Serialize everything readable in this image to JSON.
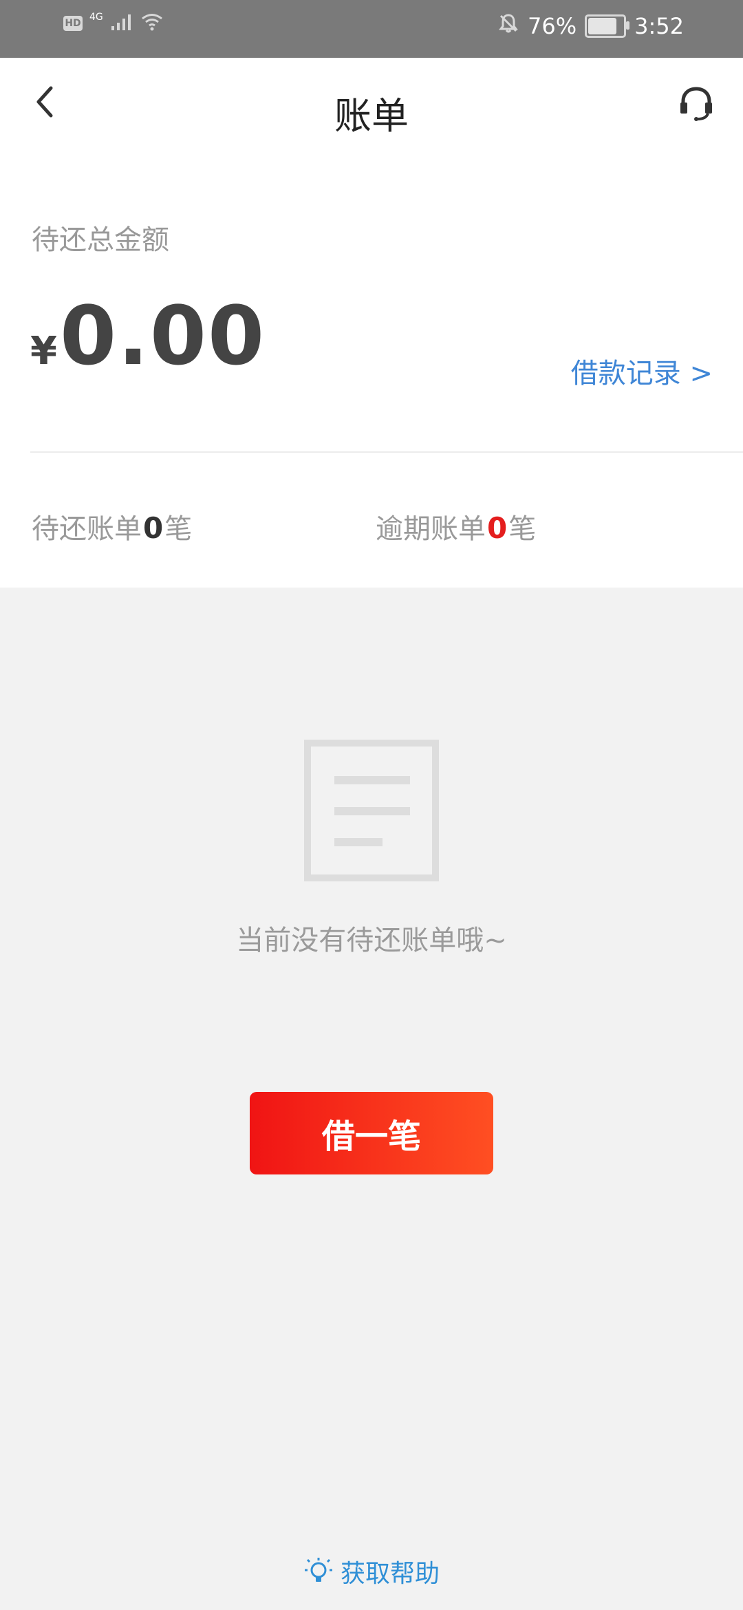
{
  "status_bar": {
    "network_type": "4G",
    "battery_percent": "76%",
    "time": "3:52"
  },
  "nav": {
    "title": "账单"
  },
  "summary": {
    "label": "待还总金额",
    "currency": "¥",
    "amount": "0.00",
    "loan_record": "借款记录 >",
    "pending_prefix": "待还账单",
    "pending_count": "0",
    "pending_suffix": "笔",
    "overdue_prefix": "逾期账单",
    "overdue_count": "0",
    "overdue_suffix": "笔"
  },
  "empty_state": {
    "message": "当前没有待还账单哦~"
  },
  "actions": {
    "borrow": "借一笔",
    "help": "获取帮助"
  },
  "colors": {
    "accent_blue": "#3f86d6",
    "warning_red": "#e41e1e",
    "primary_gradient_start": "#f01414",
    "primary_gradient_end": "#ff4f22"
  }
}
